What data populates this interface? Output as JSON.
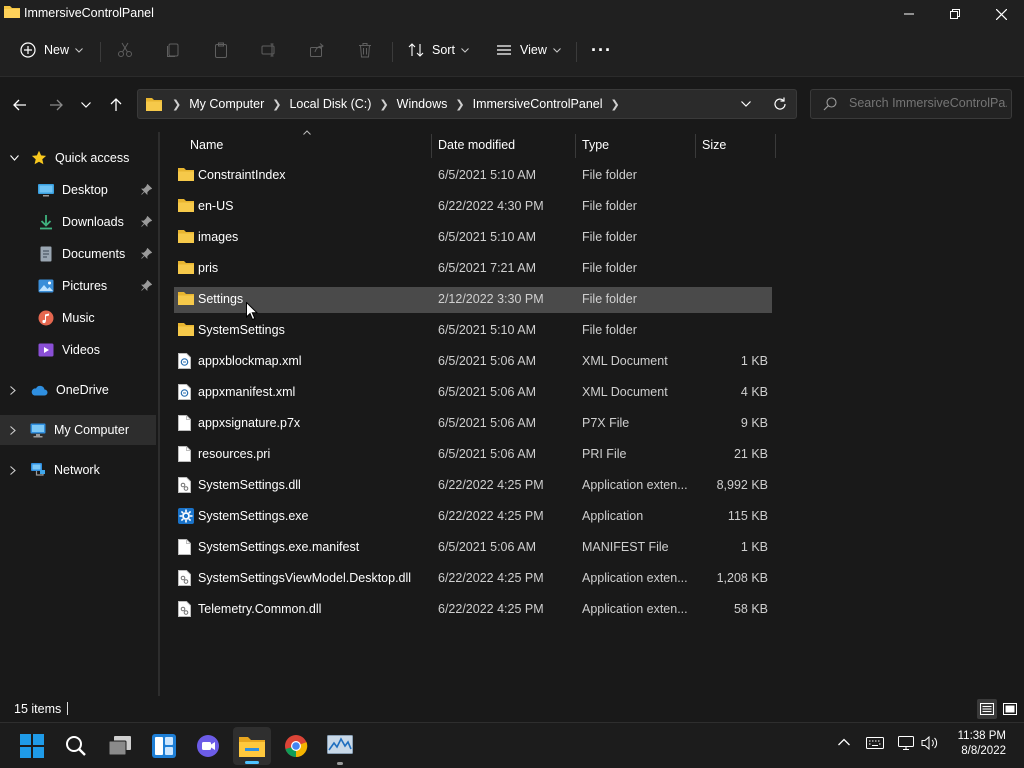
{
  "window": {
    "title": "ImmersiveControlPanel"
  },
  "toolbar": {
    "new_label": "New",
    "sort_label": "Sort",
    "view_label": "View",
    "more_label": "···"
  },
  "address": {
    "crumbs": [
      "My Computer",
      "Local Disk (C:)",
      "Windows",
      "ImmersiveControlPanel"
    ]
  },
  "search": {
    "placeholder": "Search ImmersiveControlPa..."
  },
  "nav": {
    "quick_access": "Quick access",
    "desktop": "Desktop",
    "downloads": "Downloads",
    "documents": "Documents",
    "pictures": "Pictures",
    "music": "Music",
    "videos": "Videos",
    "onedrive": "OneDrive",
    "my_computer": "My Computer",
    "network": "Network"
  },
  "columns": {
    "name": "Name",
    "date": "Date modified",
    "type": "Type",
    "size": "Size"
  },
  "files": [
    {
      "name": "ConstraintIndex",
      "date": "6/5/2021 5:10 AM",
      "type": "File folder",
      "size": "",
      "icon": "folder-icon"
    },
    {
      "name": "en-US",
      "date": "6/22/2022 4:30 PM",
      "type": "File folder",
      "size": "",
      "icon": "folder-icon"
    },
    {
      "name": "images",
      "date": "6/5/2021 5:10 AM",
      "type": "File folder",
      "size": "",
      "icon": "folder-icon"
    },
    {
      "name": "pris",
      "date": "6/5/2021 7:21 AM",
      "type": "File folder",
      "size": "",
      "icon": "folder-icon"
    },
    {
      "name": "Settings",
      "date": "2/12/2022 3:30 PM",
      "type": "File folder",
      "size": "",
      "icon": "folder-icon"
    },
    {
      "name": "SystemSettings",
      "date": "6/5/2021 5:10 AM",
      "type": "File folder",
      "size": "",
      "icon": "folder-icon"
    },
    {
      "name": "appxblockmap.xml",
      "date": "6/5/2021 5:06 AM",
      "type": "XML Document",
      "size": "1 KB",
      "icon": "xml-file-icon"
    },
    {
      "name": "appxmanifest.xml",
      "date": "6/5/2021 5:06 AM",
      "type": "XML Document",
      "size": "4 KB",
      "icon": "xml-file-icon"
    },
    {
      "name": "appxsignature.p7x",
      "date": "6/5/2021 5:06 AM",
      "type": "P7X File",
      "size": "9 KB",
      "icon": "file-icon"
    },
    {
      "name": "resources.pri",
      "date": "6/5/2021 5:06 AM",
      "type": "PRI File",
      "size": "21 KB",
      "icon": "file-icon"
    },
    {
      "name": "SystemSettings.dll",
      "date": "6/22/2022 4:25 PM",
      "type": "Application exten...",
      "size": "8,992 KB",
      "icon": "dll-file-icon"
    },
    {
      "name": "SystemSettings.exe",
      "date": "6/22/2022 4:25 PM",
      "type": "Application",
      "size": "115 KB",
      "icon": "settings-gear-icon"
    },
    {
      "name": "SystemSettings.exe.manifest",
      "date": "6/5/2021 5:06 AM",
      "type": "MANIFEST File",
      "size": "1 KB",
      "icon": "file-icon"
    },
    {
      "name": "SystemSettingsViewModel.Desktop.dll",
      "date": "6/22/2022 4:25 PM",
      "type": "Application exten...",
      "size": "1,208 KB",
      "icon": "dll-file-icon"
    },
    {
      "name": "Telemetry.Common.dll",
      "date": "6/22/2022 4:25 PM",
      "type": "Application exten...",
      "size": "58 KB",
      "icon": "dll-file-icon"
    }
  ],
  "selected_file": "Settings",
  "status": {
    "count": "15 items"
  },
  "clock": {
    "time": "11:38 PM",
    "date": "8/8/2022"
  },
  "colors": {
    "folder": "#f4c542",
    "accent": "#4cc2ff",
    "selected_row": "#4a4a4a",
    "background": "#191919"
  }
}
